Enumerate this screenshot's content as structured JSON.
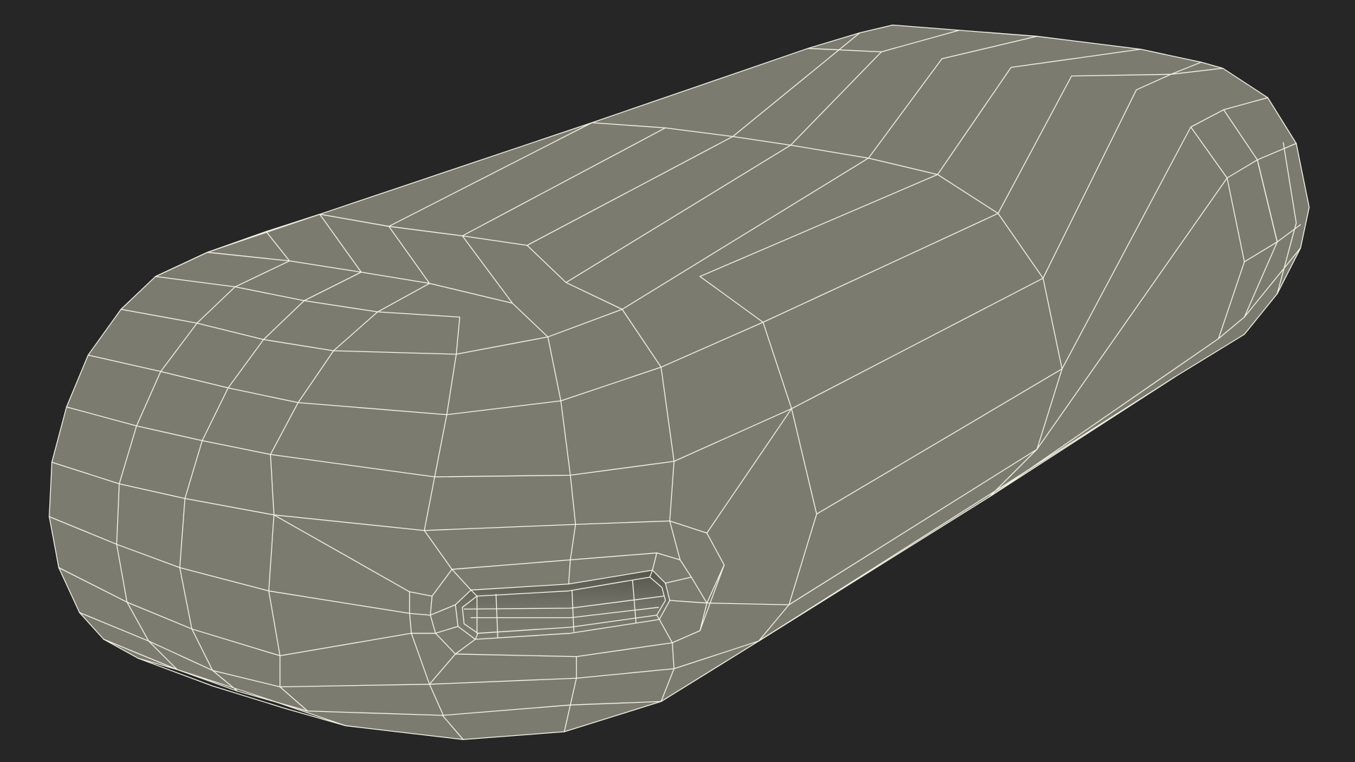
{
  "viewport": {
    "background_color": "#262626",
    "object_name": "rounded-capsule-wireframe",
    "colors": {
      "fill": "#7b7b70",
      "shade": "#6f6f64",
      "wire": "#f2f2e6",
      "slot_shadow": "#55554c"
    }
  }
}
